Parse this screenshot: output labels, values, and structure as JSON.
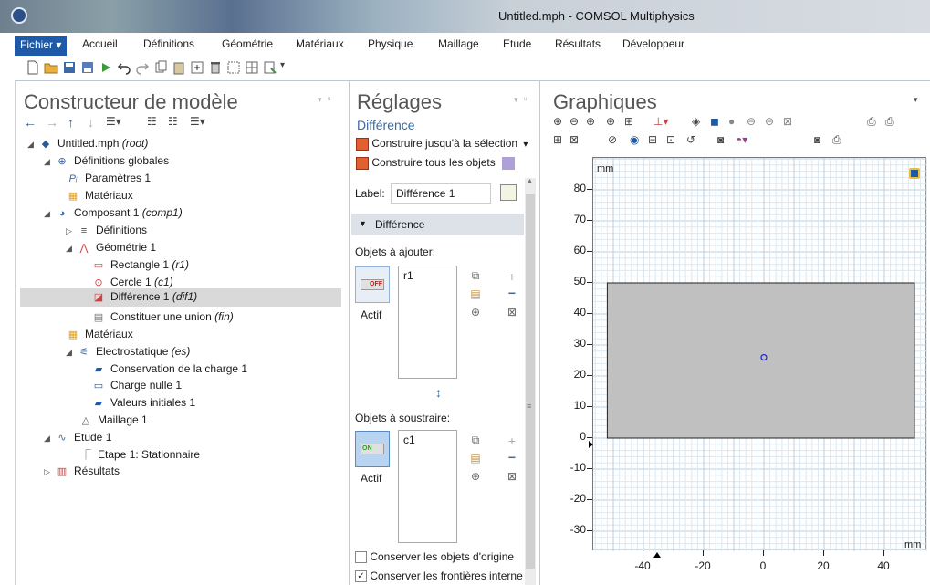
{
  "window": {
    "title": "Untitled.mph - COMSOL Multiphysics"
  },
  "menu": {
    "items": [
      "Fichier ▾",
      "Accueil",
      "Définitions",
      "Géométrie",
      "Matériaux",
      "Physique",
      "Maillage",
      "Etude",
      "Résultats",
      "Développeur"
    ]
  },
  "model_builder": {
    "title": "Constructeur de modèle",
    "tree": [
      {
        "label": "Untitled.mph",
        "tag": "(root)"
      },
      {
        "label": "Définitions globales",
        "tag": ""
      },
      {
        "label": "Paramètres 1",
        "tag": ""
      },
      {
        "label": "Matériaux",
        "tag": ""
      },
      {
        "label": "Composant 1",
        "tag": "(comp1)"
      },
      {
        "label": "Définitions",
        "tag": ""
      },
      {
        "label": "Géométrie 1",
        "tag": ""
      },
      {
        "label": "Rectangle 1",
        "tag": "(r1)"
      },
      {
        "label": "Cercle 1",
        "tag": "(c1)"
      },
      {
        "label": "Différence 1",
        "tag": "(dif1)"
      },
      {
        "label": "Constituer une union",
        "tag": "(fin)"
      },
      {
        "label": "Matériaux",
        "tag": ""
      },
      {
        "label": "Electrostatique",
        "tag": "(es)"
      },
      {
        "label": "Conservation de la charge 1",
        "tag": ""
      },
      {
        "label": "Charge nulle 1",
        "tag": ""
      },
      {
        "label": "Valeurs initiales 1",
        "tag": ""
      },
      {
        "label": "Maillage 1",
        "tag": ""
      },
      {
        "label": "Etude 1",
        "tag": ""
      },
      {
        "label": "Etape 1: Stationnaire",
        "tag": ""
      },
      {
        "label": "Résultats",
        "tag": ""
      }
    ]
  },
  "settings": {
    "title": "Réglages",
    "subtitle": "Différence",
    "build_selected": "Construire jusqu'à la sélection",
    "build_all": "Construire tous les objets",
    "label_caption": "Label:",
    "label_value": "Différence 1",
    "section": "Différence",
    "add_caption": "Objets à ajouter:",
    "add_items": [
      "r1"
    ],
    "add_toggle": "OFF",
    "add_status": "Actif",
    "subtract_caption": "Objets à soustraire:",
    "subtract_items": [
      "c1"
    ],
    "subtract_toggle": "ON",
    "subtract_status": "Actif",
    "keep_objects": "Conserver les objets d'origine",
    "keep_boundaries": "Conserver les frontières interne",
    "keep_objects_checked": false,
    "keep_boundaries_checked": true
  },
  "graphics": {
    "title": "Graphiques",
    "y_unit": "mm",
    "x_unit": "mm",
    "y_ticks": [
      "80",
      "70",
      "60",
      "50",
      "40",
      "30",
      "20",
      "10",
      "0",
      "-10",
      "-20",
      "-30"
    ],
    "x_ticks": [
      "-40",
      "-20",
      "0",
      "20",
      "40"
    ],
    "rect_color": "#c0c0c0",
    "circle_color": "#2020d0"
  }
}
